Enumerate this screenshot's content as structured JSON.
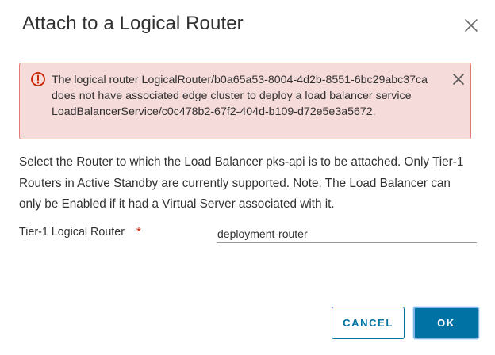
{
  "dialog": {
    "title": "Attach to a Logical Router"
  },
  "alert": {
    "type": "error",
    "icon": "error-circle-icon",
    "message": "The logical router LogicalRouter/b0a65a53-8004-4d2b-8551-6bc29abc37ca does not have associated edge cluster to deploy a load balancer service LoadBalancerService/c0c478b2-67f2-404d-b109-d72e5e3a5672."
  },
  "description": "Select the Router to which the Load Balancer pks-api is to be attached. Only Tier-1 Routers in Active Standby are currently supported. Note: The Load Balancer can only be Enabled if it had a Virtual Server associated with it.",
  "form": {
    "router_label": "Tier-1 Logical Router",
    "required_mark": "*",
    "router_value": "deployment-router"
  },
  "buttons": {
    "cancel": "CANCEL",
    "ok": "OK"
  },
  "colors": {
    "primary": "#0072a3",
    "alert_bg": "#f5dbd9",
    "alert_border": "#e27c73",
    "error_icon": "#c92100"
  }
}
